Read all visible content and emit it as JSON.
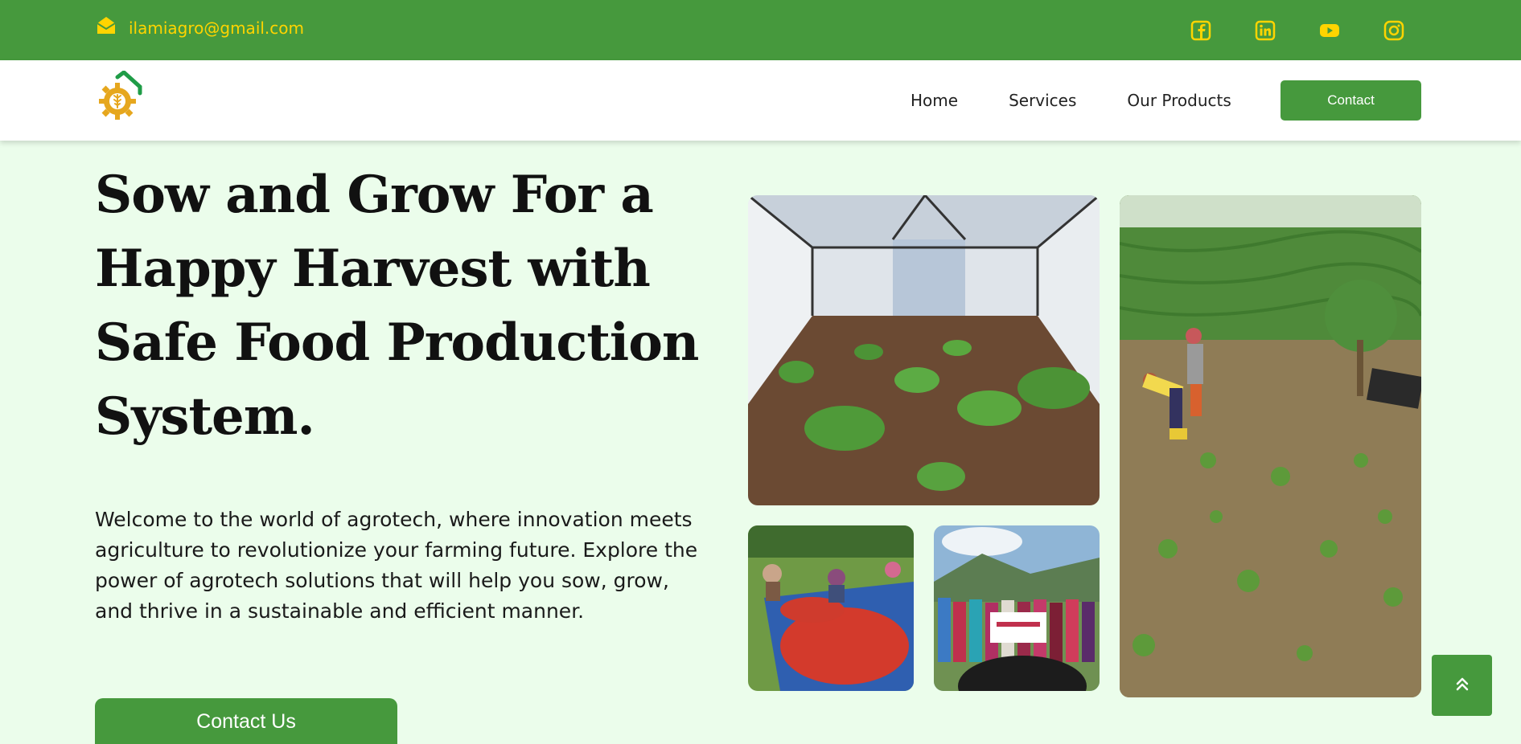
{
  "topbar": {
    "email": "ilamiagro@gmail.com",
    "socials": [
      "facebook-icon",
      "linkedin-icon",
      "youtube-icon",
      "instagram-icon"
    ]
  },
  "nav": {
    "links": [
      "Home",
      "Services",
      "Our Products"
    ],
    "contact_label": "Contact"
  },
  "hero": {
    "title": "Sow and Grow For a Happy Harvest with Safe Food Production System.",
    "description": "Welcome to the world of agrotech, where innovation meets agriculture to revolutionize your farming future. Explore the power of agrotech solutions that will help you sow, grow, and thrive in a sustainable and efficient manner.",
    "cta_label": "Contact Us"
  },
  "colors": {
    "brand_green": "#46993d",
    "accent_yellow": "#ffd400",
    "hero_background": "#ebfdeb"
  }
}
